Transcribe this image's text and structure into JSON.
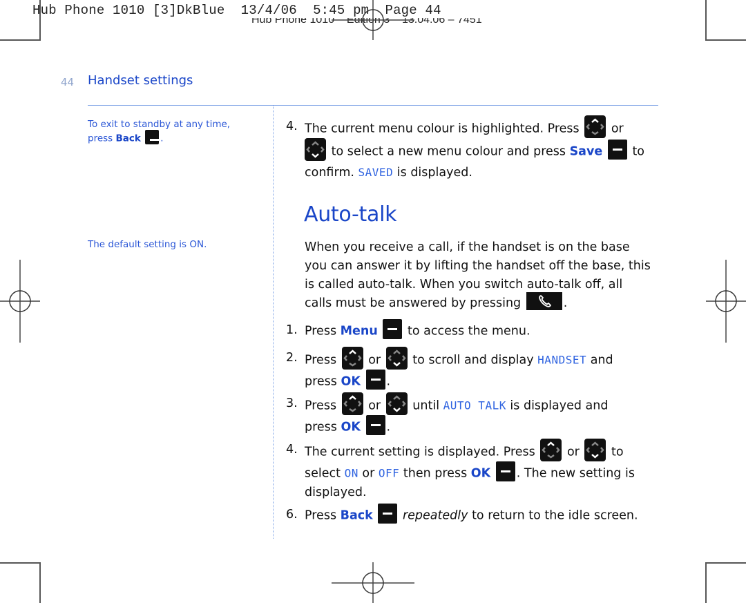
{
  "print_marks": {
    "slug_line": "Hub Phone 1010 [3]DkBlue  13/4/06  5:45 pm  Page 44",
    "edition_line": "Hub Phone 1010 – Edition 3 – 13.04.06 – 7451"
  },
  "header": {
    "page_number": "44",
    "section_title": "Handset settings"
  },
  "sidebar": {
    "note_exit": {
      "line1": "To exit to standby at any time,",
      "prefix": "press ",
      "keyword": "Back",
      "suffix": "."
    },
    "note_default": "The default setting is ON."
  },
  "previous_step": {
    "number": "4.",
    "part1": "The current menu colour is highlighted. Press",
    "or": "or",
    "part2": "to select a new menu colour and press",
    "save_keyword": "Save",
    "to": "to",
    "confirm": "confirm.",
    "lcd_saved": "SAVED",
    "is_displayed": "is displayed."
  },
  "auto_talk": {
    "heading": "Auto-talk",
    "intro_line1": "When you receive a call, if the handset is on the base",
    "intro_line2": "you can answer it by lifting the handset off the base, this",
    "intro_line3": "is called auto-talk. When you switch auto-talk off, all",
    "intro_line4": "calls must be answered by pressing",
    "intro_end": ".",
    "steps": [
      {
        "number": "1.",
        "press": "Press",
        "keyword": "Menu",
        "rest": "to access the menu."
      },
      {
        "number": "2.",
        "press": "Press",
        "or": "or",
        "mid": "to scroll and display",
        "lcd": "HANDSET",
        "and": "and",
        "press2": "press",
        "keyword": "OK",
        "end": "."
      },
      {
        "number": "3.",
        "press": "Press",
        "or": "or",
        "mid": "until",
        "lcd": "AUTO TALK",
        "after": "is displayed and",
        "press2": "press",
        "keyword": "OK",
        "end": "."
      },
      {
        "number": "4.",
        "part1": "The current setting is displayed. Press",
        "or": "or",
        "to": "to",
        "select": "select",
        "lcd_on": "ON",
        "or2": "or",
        "lcd_off": "OFF",
        "then_press": "then press",
        "keyword": "OK",
        "after": ". The new setting is",
        "line3": "displayed."
      },
      {
        "number": "6.",
        "press": "Press",
        "keyword": "Back",
        "emphasis": "repeatedly",
        "rest": "to return to the idle screen."
      }
    ]
  },
  "icons": {
    "softkey": "softkey-minus-icon",
    "navigation": "navigation-key-icon",
    "talk": "talk-phone-icon"
  },
  "colors": {
    "heading_blue": "#1a46c8",
    "note_blue": "#2a56d6",
    "lcd_blue": "#2f63e0",
    "rule_blue": "#7ea3e6"
  }
}
